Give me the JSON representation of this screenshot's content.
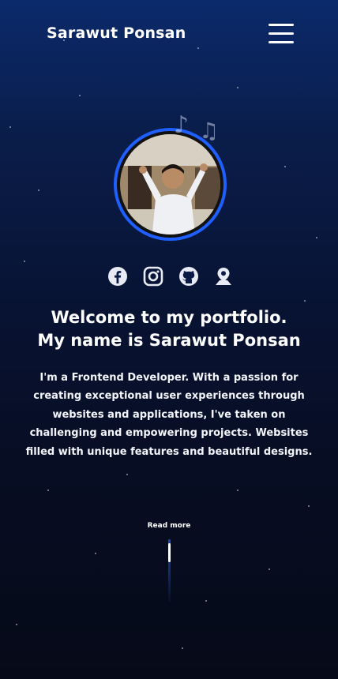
{
  "header": {
    "brand": "Sarawut Ponsan",
    "menu_icon": "hamburger-menu-icon"
  },
  "profile": {
    "photo_description_icon": "profile-photo",
    "decoration_icon": "music-notes-icon"
  },
  "socials": [
    {
      "icon": "facebook-icon"
    },
    {
      "icon": "instagram-icon"
    },
    {
      "icon": "github-icon"
    },
    {
      "icon": "location-icon"
    }
  ],
  "hero": {
    "headline_line1": "Welcome to my portfolio.",
    "headline_line2": "My name is Sarawut Ponsan",
    "intro": "I'm a Frontend Developer. With a passion for creating exceptional user experiences through websites and applications, I've taken on challenging and empowering projects. Websites filled with unique features and beautiful designs."
  },
  "cta": {
    "read_more": "Read more"
  },
  "colors": {
    "accent": "#1f5fff",
    "background_top": "#0b2a6b",
    "background_bottom": "#060a18"
  }
}
